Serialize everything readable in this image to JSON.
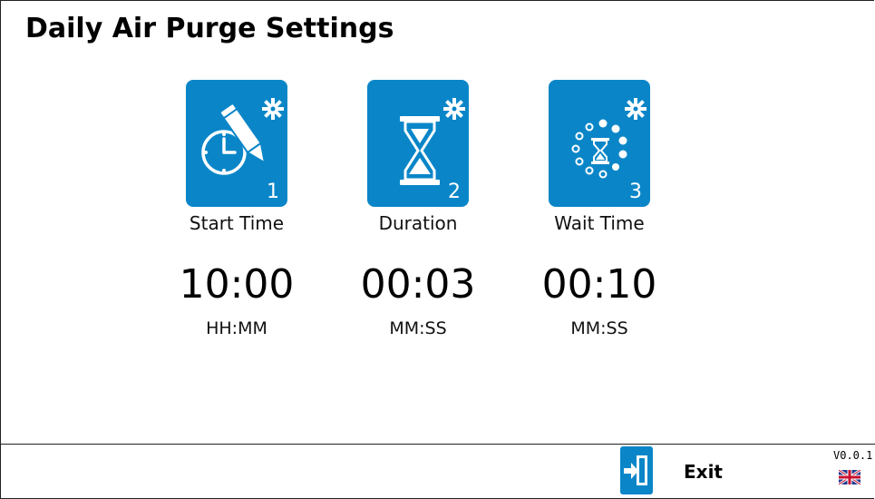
{
  "header": {
    "title": "Daily Air Purge Settings"
  },
  "settings": [
    {
      "icon": "clock-pencil-gear-icon",
      "number": "1",
      "label": "Start Time",
      "value": "10:00",
      "unit": "HH:MM"
    },
    {
      "icon": "hourglass-gear-icon",
      "number": "2",
      "label": "Duration",
      "value": "00:03",
      "unit": "MM:SS"
    },
    {
      "icon": "dotted-circle-hourglass-gear-icon",
      "number": "3",
      "label": "Wait Time",
      "value": "00:10",
      "unit": "MM:SS"
    }
  ],
  "footer": {
    "exit_label": "Exit",
    "exit_icon": "exit-door-icon",
    "version": "V0.0.1",
    "language_icon": "uk-flag-icon"
  },
  "colors": {
    "accent": "#0a86c8",
    "background": "#ffffff",
    "text": "#000000"
  }
}
